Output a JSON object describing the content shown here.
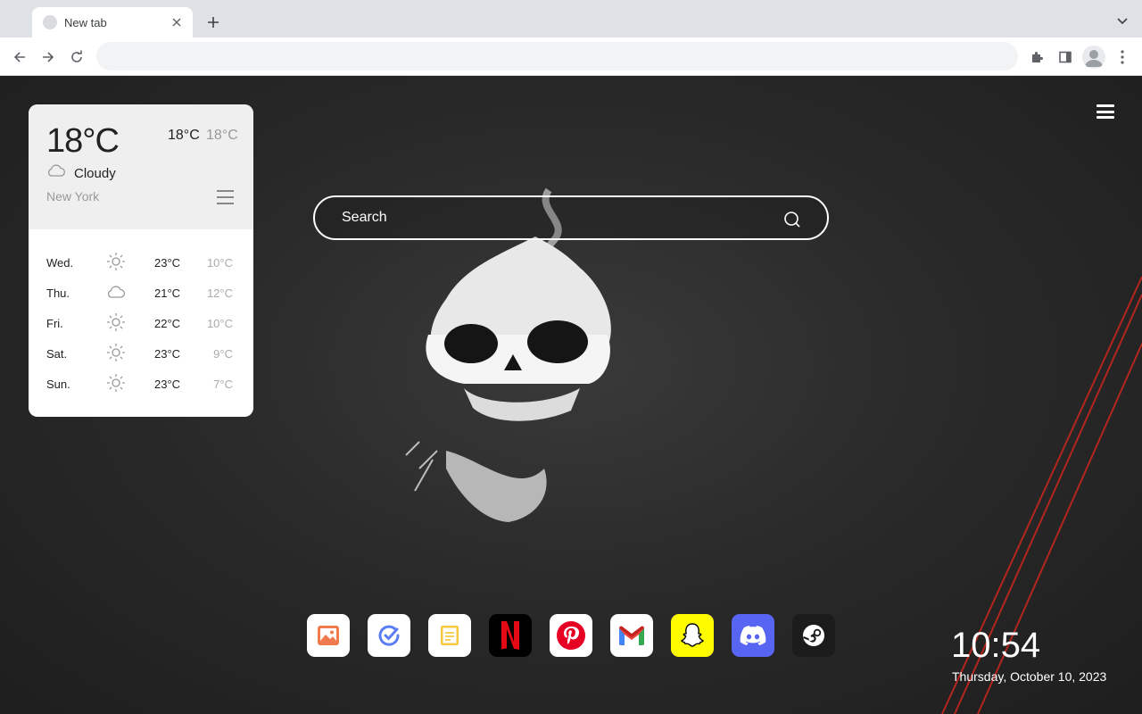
{
  "browser": {
    "tab": {
      "title": "New tab",
      "favicon": "default-favicon-icon"
    },
    "omnibox": {
      "value": "",
      "placeholder": ""
    },
    "icons": [
      "back-arrow-icon",
      "forward-arrow-icon",
      "reload-icon",
      "extensions-puzzle-icon",
      "side-panel-icon",
      "profile-avatar-icon",
      "kebab-menu-icon",
      "new-tab-plus-icon",
      "tab-search-chevron-icon",
      "close-icon"
    ]
  },
  "weather": {
    "current_temp": "18°C",
    "high": "18°C",
    "low": "18°C",
    "condition": "Cloudy",
    "condition_icon": "cloud-icon",
    "city": "New York",
    "forecast": [
      {
        "day": "Wed.",
        "icon": "sun-icon",
        "high": "23°C",
        "low": "10°C"
      },
      {
        "day": "Thu.",
        "icon": "cloud-icon",
        "high": "21°C",
        "low": "12°C"
      },
      {
        "day": "Fri.",
        "icon": "sun-icon",
        "high": "22°C",
        "low": "10°C"
      },
      {
        "day": "Sat.",
        "icon": "sun-icon",
        "high": "23°C",
        "low": "9°C"
      },
      {
        "day": "Sun.",
        "icon": "sun-icon",
        "high": "23°C",
        "low": "7°C"
      }
    ]
  },
  "search": {
    "placeholder": "Search",
    "icon": "search-icon"
  },
  "dock": [
    {
      "name": "wallpaper-gallery",
      "icon": "image-icon",
      "color": "#ffffff"
    },
    {
      "name": "todo",
      "icon": "todo-check-icon",
      "color": "#ffffff"
    },
    {
      "name": "notes",
      "icon": "notes-icon",
      "color": "#ffffff"
    },
    {
      "name": "netflix",
      "icon": "netflix-icon",
      "color": "#000000"
    },
    {
      "name": "pinterest",
      "icon": "pinterest-icon",
      "color": "#ffffff"
    },
    {
      "name": "gmail",
      "icon": "gmail-icon",
      "color": "#ffffff"
    },
    {
      "name": "snapchat",
      "icon": "snapchat-icon",
      "color": "#fffc00"
    },
    {
      "name": "discord",
      "icon": "discord-icon",
      "color": "#5865f2"
    },
    {
      "name": "steam",
      "icon": "steam-icon",
      "color": "#1b1b1b"
    }
  ],
  "clock": {
    "time": "10:54",
    "date": "Thursday, October 10, 2023"
  },
  "colors": {
    "accent_red": "#c62828",
    "page_bg": "#262626",
    "chrome_bg": "#dee1e6"
  }
}
